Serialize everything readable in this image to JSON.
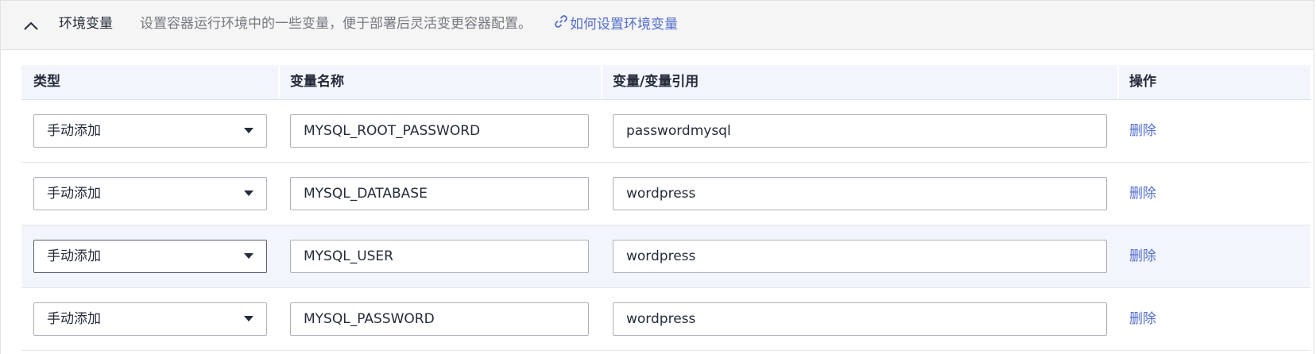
{
  "section": {
    "title": "环境变量",
    "description": "设置容器运行环境中的一些变量，便于部署后灵活变更容器配置。",
    "help_link": "如何设置环境变量"
  },
  "table": {
    "headers": {
      "type": "类型",
      "name": "变量名称",
      "value": "变量/变量引用",
      "action": "操作"
    },
    "rows": [
      {
        "type": "手动添加",
        "name": "MYSQL_ROOT_PASSWORD",
        "value": "passwordmysql",
        "action": "删除"
      },
      {
        "type": "手动添加",
        "name": "MYSQL_DATABASE",
        "value": "wordpress",
        "action": "删除"
      },
      {
        "type": "手动添加",
        "name": "MYSQL_USER",
        "value": "wordpress",
        "action": "删除"
      },
      {
        "type": "手动添加",
        "name": "MYSQL_PASSWORD",
        "value": "wordpress",
        "action": "删除"
      }
    ]
  },
  "icons": {
    "collapse": "chevron-up-icon",
    "link": "link-icon",
    "dropdown": "caret-down-icon"
  },
  "colors": {
    "link": "#526ecc",
    "header_bg": "#f2f5fc",
    "section_bg": "#f5f5f6",
    "border": "#adb0b8"
  }
}
